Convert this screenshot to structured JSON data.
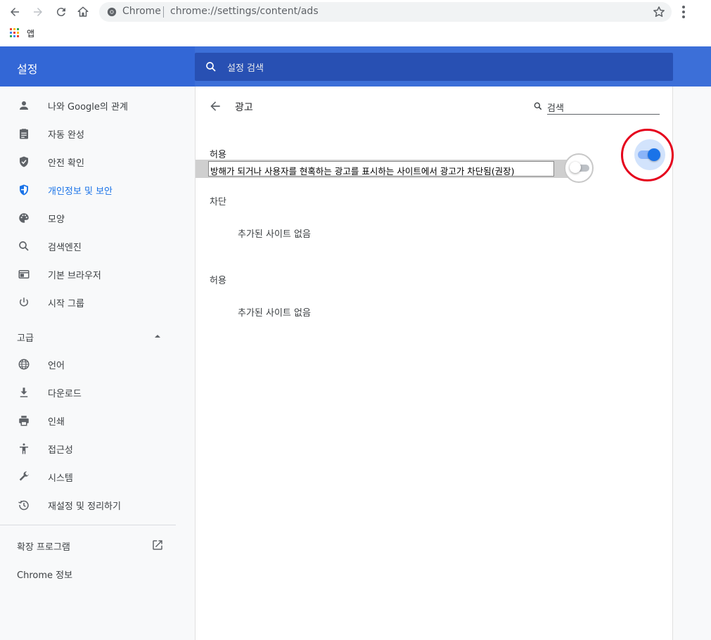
{
  "browser": {
    "omnibox": {
      "chip": "Chrome",
      "url": "chrome://settings/content/ads"
    },
    "bookmarks": {
      "apps_label": "앱"
    }
  },
  "header": {
    "title": "설정",
    "search_placeholder": "설정 검색"
  },
  "sidebar": {
    "items": [
      {
        "label": "나와 Google의 관계",
        "icon": "person-icon"
      },
      {
        "label": "자동 완성",
        "icon": "clipboard-icon"
      },
      {
        "label": "안전 확인",
        "icon": "shield-check-icon"
      },
      {
        "label": "개인정보 및 보안",
        "icon": "shield-icon",
        "active": true
      },
      {
        "label": "모양",
        "icon": "palette-icon"
      },
      {
        "label": "검색엔진",
        "icon": "search-icon"
      },
      {
        "label": "기본 브라우저",
        "icon": "browser-icon"
      },
      {
        "label": "시작 그룹",
        "icon": "power-icon"
      }
    ],
    "advanced_label": "고급",
    "advanced_items": [
      {
        "label": "언어",
        "icon": "globe-icon"
      },
      {
        "label": "다운로드",
        "icon": "download-icon"
      },
      {
        "label": "인쇄",
        "icon": "printer-icon"
      },
      {
        "label": "접근성",
        "icon": "accessibility-icon"
      },
      {
        "label": "시스템",
        "icon": "wrench-icon"
      },
      {
        "label": "재설정 및 정리하기",
        "icon": "restore-icon"
      }
    ],
    "extensions_label": "확장 프로그램",
    "about_label": "Chrome 정보"
  },
  "main": {
    "page_title": "광고",
    "search_placeholder": "검색",
    "allow_heading": "허용",
    "ad_setting_description": "방해가 되거나 사용자를 현혹하는 광고를 표시하는 사이트에서 광고가 차단됨(권장)",
    "ad_toggle_on": true,
    "block_heading": "차단",
    "block_empty": "추가된 사이트 없음",
    "allow_list_heading": "허용",
    "allow_empty": "추가된 사이트 없음"
  },
  "colors": {
    "header_blue": "#3367d6",
    "accent": "#1a73e8",
    "highlight_circle": "#e5001c"
  }
}
